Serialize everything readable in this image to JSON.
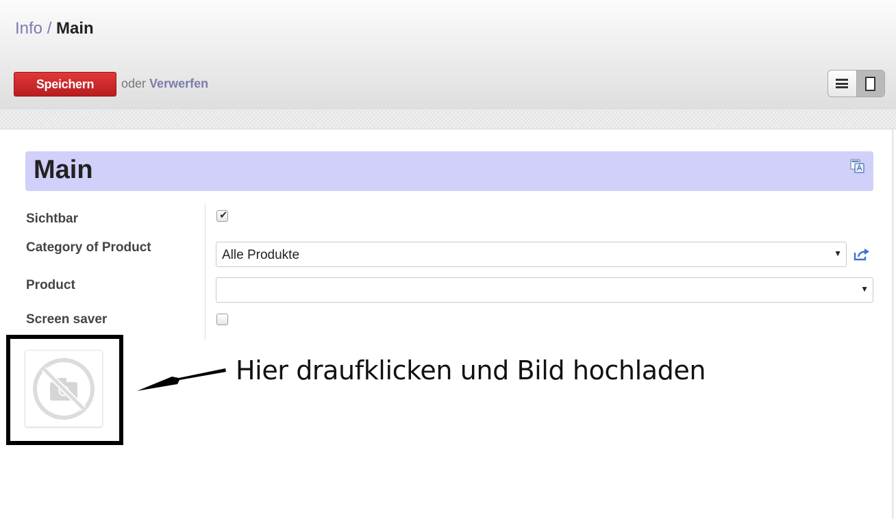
{
  "breadcrumb": {
    "parent": "Info",
    "separator": " / ",
    "current": "Main"
  },
  "toolbar": {
    "save_label": "Speichern",
    "or_text": "oder",
    "discard_label": "Verwerfen"
  },
  "view_switcher": {
    "options": [
      "list-view",
      "form-view"
    ],
    "active": "form-view"
  },
  "form": {
    "title": "Main",
    "fields": [
      {
        "label": "Sichtbar",
        "type": "checkbox",
        "checked": true
      },
      {
        "label": "Category of Product",
        "type": "select",
        "value": "Alle Produkte"
      },
      {
        "label": "Product",
        "type": "select",
        "value": ""
      },
      {
        "label": "Screen saver",
        "type": "checkbox",
        "checked": false
      }
    ]
  },
  "image_field": {
    "icon": "no-image-icon"
  },
  "annotation": {
    "text": "Hier draufklicken und Bild hochladen"
  },
  "colors": {
    "link": "#7c7bad",
    "save_button": "#c9262a",
    "title_bar": "#d0d0fb"
  }
}
